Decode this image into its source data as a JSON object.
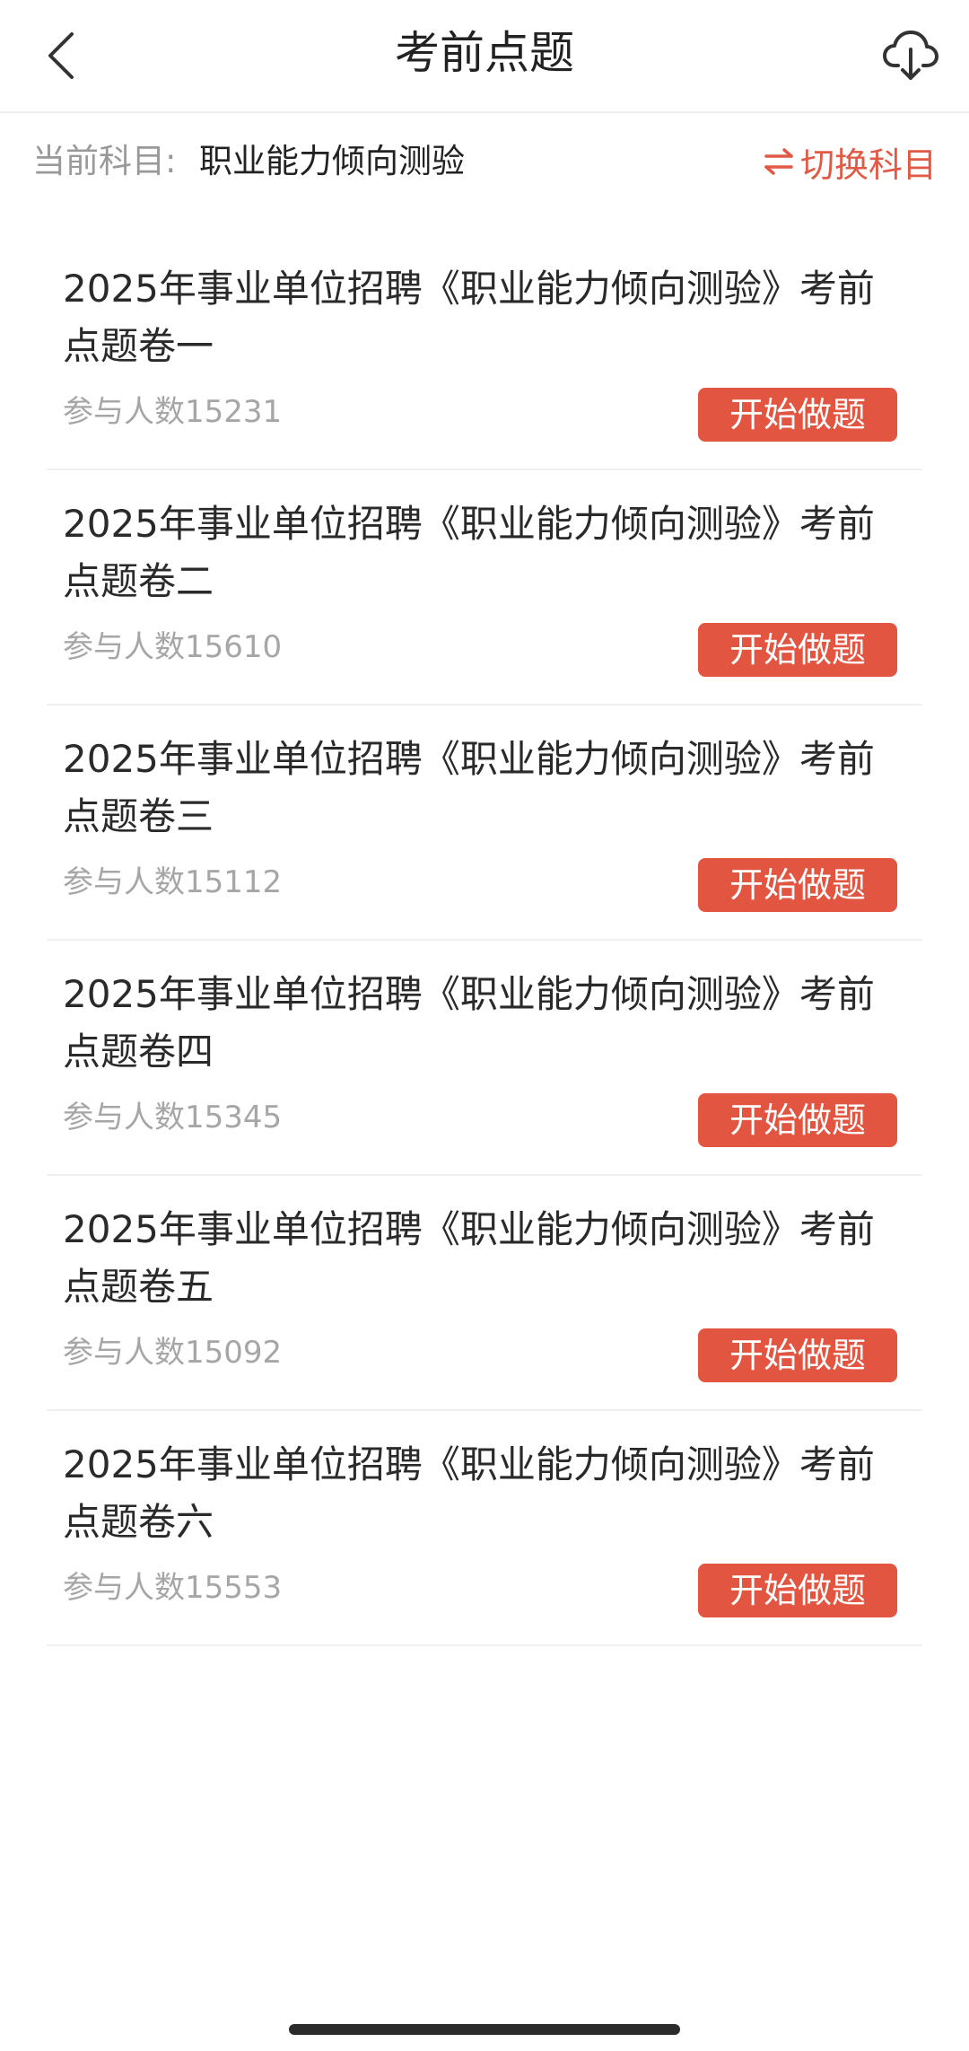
{
  "header": {
    "title": "考前点题",
    "back_icon": "chevron-left-icon",
    "download_icon": "cloud-download-icon"
  },
  "subject": {
    "label": "当前科目:",
    "value": "职业能力倾向测验",
    "switch_label": "切换科目",
    "switch_icon": "swap-arrows-icon"
  },
  "colors": {
    "accent": "#e25541",
    "muted_text": "#a6a6a6",
    "primary_text": "#2a2a2a"
  },
  "papers": [
    {
      "title": "2025年事业单位招聘《职业能力倾向测验》考前点题卷一",
      "count": "参与人数15231",
      "button": "开始做题"
    },
    {
      "title": "2025年事业单位招聘《职业能力倾向测验》考前点题卷二",
      "count": "参与人数15610",
      "button": "开始做题"
    },
    {
      "title": "2025年事业单位招聘《职业能力倾向测验》考前点题卷三",
      "count": "参与人数15112",
      "button": "开始做题"
    },
    {
      "title": "2025年事业单位招聘《职业能力倾向测验》考前点题卷四",
      "count": "参与人数15345",
      "button": "开始做题"
    },
    {
      "title": "2025年事业单位招聘《职业能力倾向测验》考前点题卷五",
      "count": "参与人数15092",
      "button": "开始做题"
    },
    {
      "title": "2025年事业单位招聘《职业能力倾向测验》考前点题卷六",
      "count": "参与人数15553",
      "button": "开始做题"
    }
  ]
}
